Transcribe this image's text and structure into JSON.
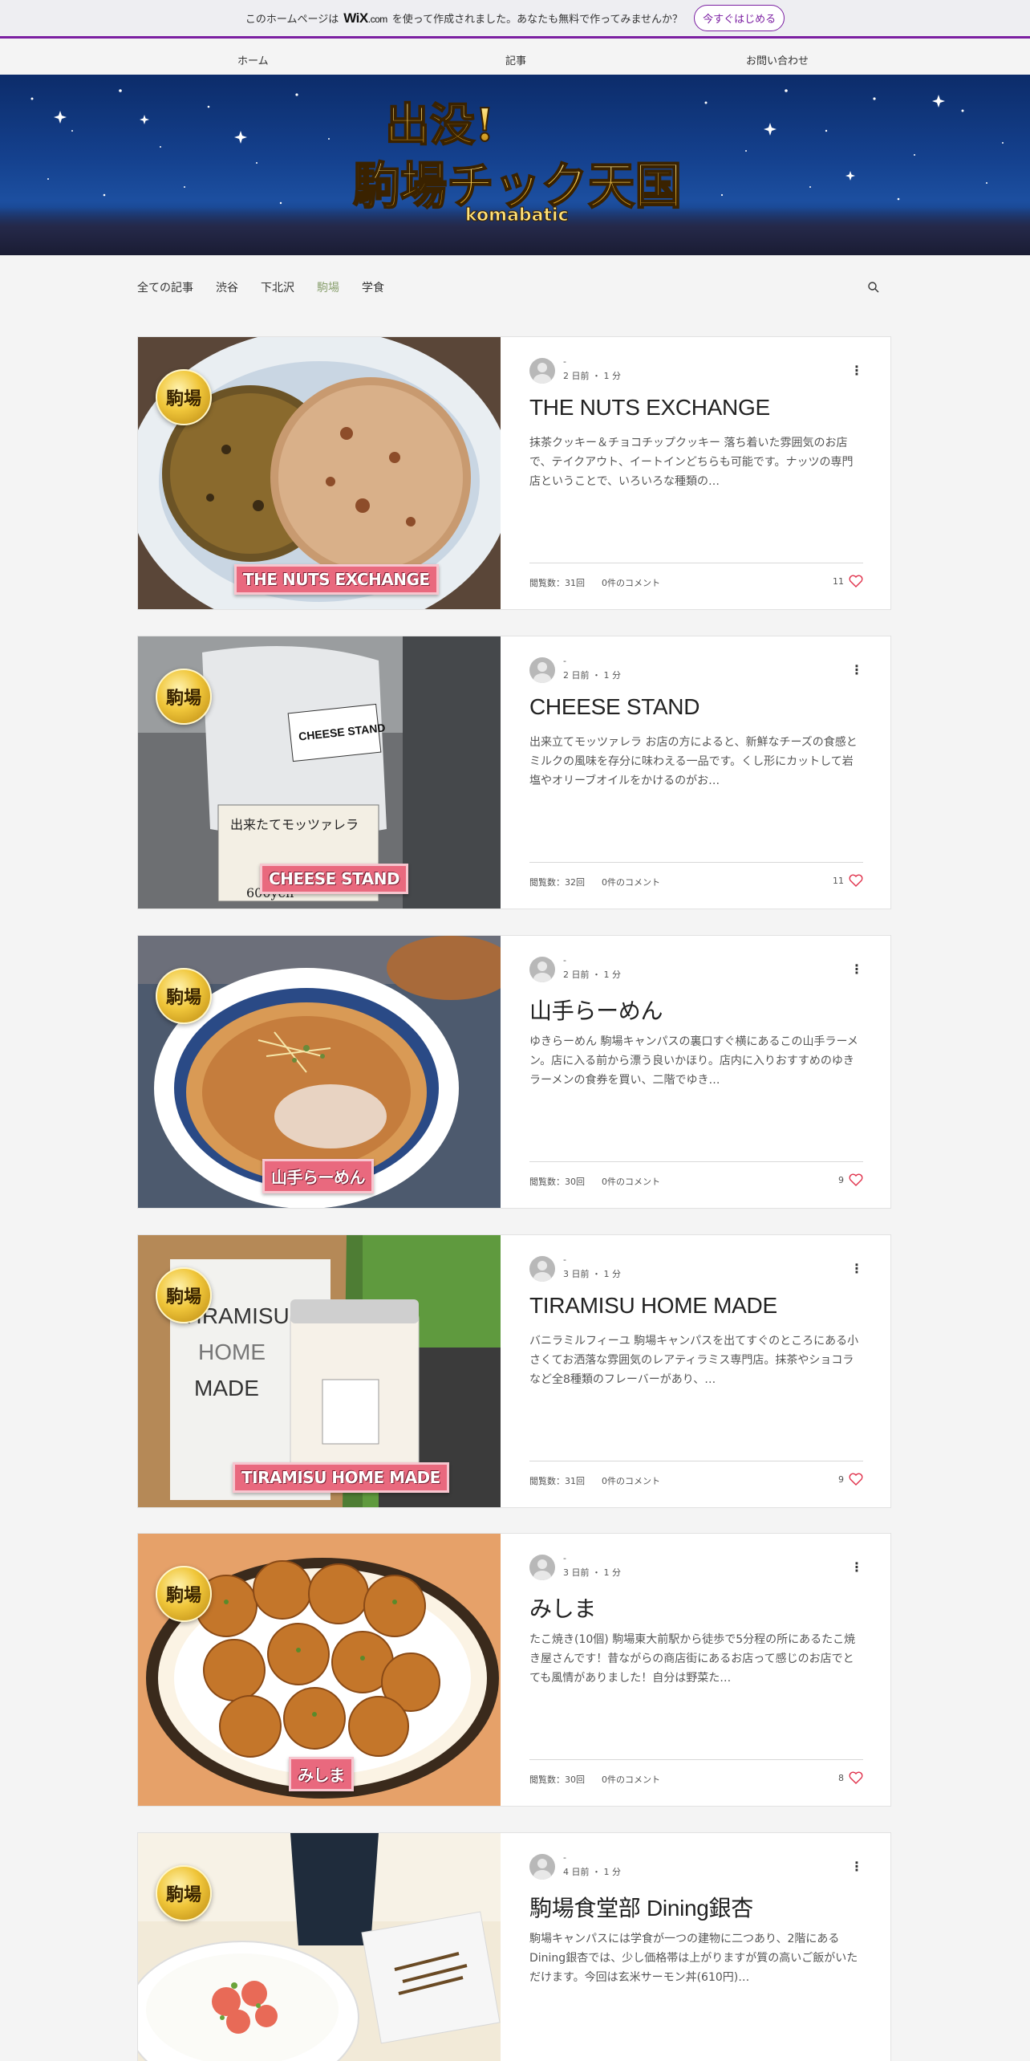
{
  "wix_bar": {
    "text_before": "このホームページは",
    "logo": "WiX",
    "logo_suffix": ".com",
    "text_after": "を使って作成されました。あなたも無料で作ってみませんか？",
    "button": "今すぐはじめる"
  },
  "nav": {
    "items": [
      "ホーム",
      "記事",
      "お問い合わせ"
    ]
  },
  "banner": {
    "line1": "出没!",
    "line2": "駒場チック天国",
    "sub": "komabatic"
  },
  "categories": {
    "items": [
      "全ての記事",
      "渋谷",
      "下北沢",
      "駒場",
      "学食"
    ],
    "active": "駒場"
  },
  "posts": [
    {
      "badge": "駒場",
      "caption": "THE NUTS EXCHANGE",
      "author": "-",
      "meta": "2 日前 ・ 1 分",
      "title": "THE NUTS EXCHANGE",
      "excerpt": "抹茶クッキー＆チョコチップクッキー 落ち着いた雰囲気のお店で、テイクアウト、イートインどちらも可能です。ナッツの専門店ということで、いろいろな種類の…",
      "views": "閲覧数：31回",
      "comments": "0件のコメント",
      "likes": "11"
    },
    {
      "badge": "駒場",
      "caption": "CHEESE STAND",
      "author": "-",
      "meta": "2 日前 ・ 1 分",
      "title": "CHEESE STAND",
      "excerpt": "出来立てモッツァレラ お店の方によると、新鮮なチーズの食感とミルクの風味を存分に味わえる一品です。くし形にカットして岩塩やオリーブオイルをかけるのがお…",
      "views": "閲覧数：32回",
      "comments": "0件のコメント",
      "likes": "11"
    },
    {
      "badge": "駒場",
      "caption": "山手らーめん",
      "author": "-",
      "meta": "2 日前 ・ 1 分",
      "title": "山手らーめん",
      "excerpt": "ゆきらーめん 駒場キャンパスの裏口すぐ横にあるこの山手ラーメン。店に入る前から漂う良いかほり。店内に入りおすすめのゆきラーメンの食券を買い、二階でゆき…",
      "views": "閲覧数：30回",
      "comments": "0件のコメント",
      "likes": "9"
    },
    {
      "badge": "駒場",
      "caption": "TIRAMISU HOME MADE",
      "author": "-",
      "meta": "3 日前 ・ 1 分",
      "title": "TIRAMISU HOME MADE",
      "excerpt": "バニラミルフィーユ 駒場キャンパスを出てすぐのところにある小さくてお洒落な雰囲気のレアティラミス専門店。抹茶やショコラなど全8種類のフレーバーがあり、…",
      "views": "閲覧数：31回",
      "comments": "0件のコメント",
      "likes": "9"
    },
    {
      "badge": "駒場",
      "caption": "みしま",
      "author": "-",
      "meta": "3 日前 ・ 1 分",
      "title": "みしま",
      "excerpt": "たこ焼き(10個) 駒場東大前駅から徒歩で5分程の所にあるたこ焼き屋さんです！昔ながらの商店街にあるお店って感じのお店でとても風情がありました！自分は野菜た…",
      "views": "閲覧数：30回",
      "comments": "0件のコメント",
      "likes": "8"
    },
    {
      "badge": "駒場",
      "caption": "",
      "author": "-",
      "meta": "4 日前 ・ 1 分",
      "title": "駒場食堂部 Dining銀杏",
      "excerpt": "駒場キャンパスには学食が一つの建物に二つあり、2階にあるDining銀杏では、少し価格帯は上がりますが質の高いご飯がいただけます。今回は玄米サーモン丼(610円)…",
      "views": "",
      "comments": "",
      "likes": ""
    }
  ],
  "colors": {
    "accent_purple": "#7b1fa2",
    "active_category": "#8aa06f",
    "heart": "#e0314b",
    "caption_pink": "#e9697e"
  }
}
